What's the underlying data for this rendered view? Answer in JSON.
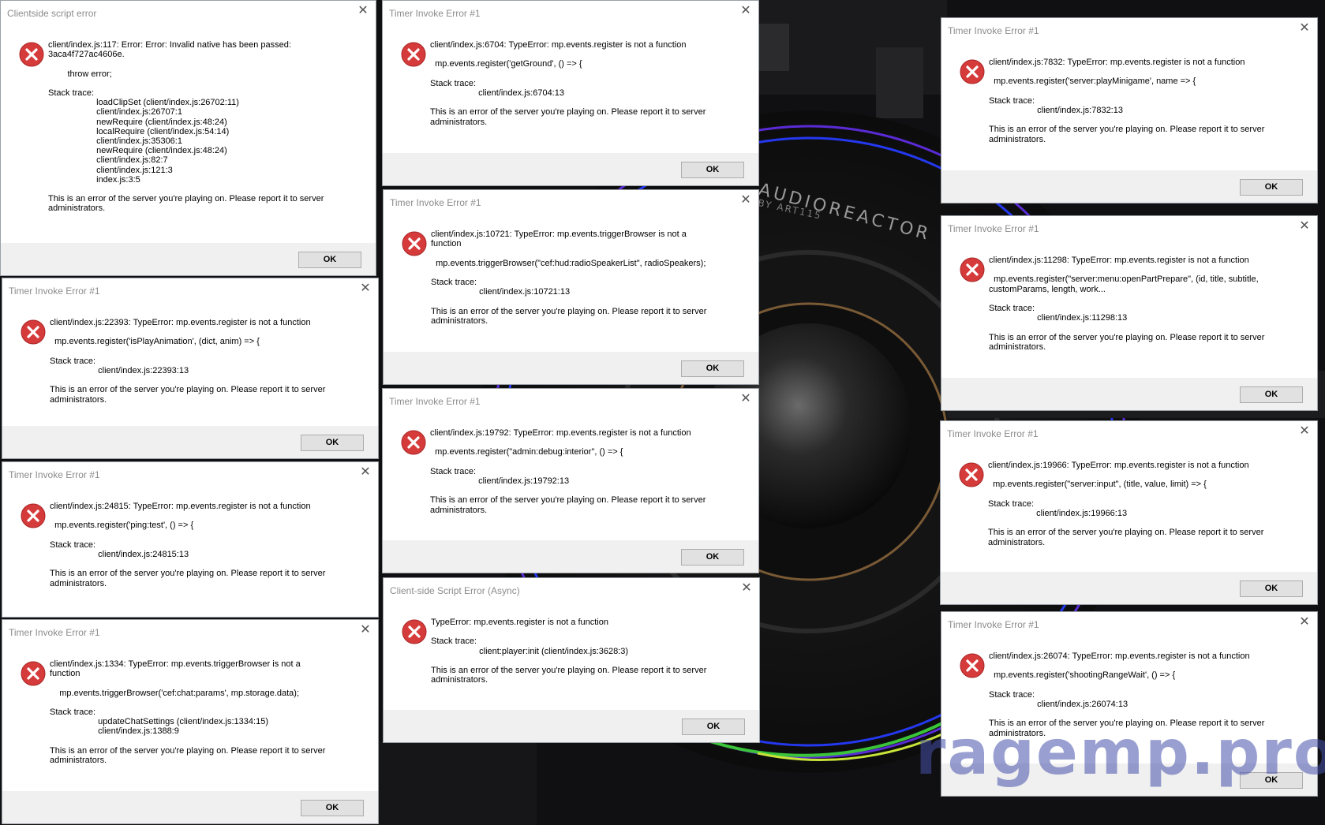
{
  "watermark": "ragemp.pro",
  "wallpaper_brand": "AUDIOREACTOR",
  "wallpaper_brand_sub": "BY ART115",
  "colors": {
    "error_icon": "#d63b3b",
    "dialog_footer": "#f0f0f0",
    "ring_purple": "#5a2bd6",
    "ring_blue": "#2438f0",
    "ring_green": "#39c43a",
    "ring_yellow": "#c8e33a"
  },
  "dialogs": [
    {
      "title": "Clientside script error",
      "message": "client/index.js:117: Error: Error: Invalid native has been passed:\n3aca4f727ac4606e.\n\n        throw error;\n\nStack trace:\n                    loadClipSet (client/index.js:26702:11)\n                    client/index.js:26707:1\n                    newRequire (client/index.js:48:24)\n                    localRequire (client/index.js:54:14)\n                    client/index.js:35306:1\n                    newRequire (client/index.js:48:24)\n                    client/index.js:82:7\n                    client/index.js:121:3\n                    index.js:3:5\n\nThis is an error of the server you're playing on. Please report it to server\nadministrators.",
      "ok_label": "OK"
    },
    {
      "title": "Timer Invoke Error #1",
      "message": "client/index.js:22393: TypeError: mp.events.register is not a function\n\n  mp.events.register('isPlayAnimation', (dict, anim) => {\n\nStack trace:\n                    client/index.js:22393:13\n\nThis is an error of the server you're playing on. Please report it to server\nadministrators.",
      "ok_label": "OK"
    },
    {
      "title": "Timer Invoke Error #1",
      "message": "client/index.js:24815: TypeError: mp.events.register is not a function\n\n  mp.events.register('ping:test', () => {\n\nStack trace:\n                    client/index.js:24815:13\n\nThis is an error of the server you're playing on. Please report it to server\nadministrators.",
      "ok_label": "OK"
    },
    {
      "title": "Timer Invoke Error #1",
      "message": "client/index.js:1334: TypeError: mp.events.triggerBrowser is not a\nfunction\n\n    mp.events.triggerBrowser('cef:chat:params', mp.storage.data);\n\nStack trace:\n                    updateChatSettings (client/index.js:1334:15)\n                    client/index.js:1388:9\n\nThis is an error of the server you're playing on. Please report it to server\nadministrators.",
      "ok_label": "OK"
    },
    {
      "title": "Timer Invoke Error #1",
      "message": "client/index.js:6704: TypeError: mp.events.register is not a function\n\n  mp.events.register('getGround', () => {\n\nStack trace:\n                    client/index.js:6704:13\n\nThis is an error of the server you're playing on. Please report it to server\nadministrators.",
      "ok_label": "OK"
    },
    {
      "title": "Timer Invoke Error #1",
      "message": "client/index.js:10721: TypeError: mp.events.triggerBrowser is not a\nfunction\n\n  mp.events.triggerBrowser(\"cef:hud:radioSpeakerList\", radioSpeakers);\n\nStack trace:\n                    client/index.js:10721:13\n\nThis is an error of the server you're playing on. Please report it to server\nadministrators.",
      "ok_label": "OK"
    },
    {
      "title": "Timer Invoke Error #1",
      "message": "client/index.js:19792: TypeError: mp.events.register is not a function\n\n  mp.events.register(\"admin:debug:interior\", () => {\n\nStack trace:\n                    client/index.js:19792:13\n\nThis is an error of the server you're playing on. Please report it to server\nadministrators.",
      "ok_label": "OK"
    },
    {
      "title": "Client-side Script Error (Async)",
      "message": "TypeError: mp.events.register is not a function\n\nStack trace:\n                    client:player:init (client/index.js:3628:3)\n\nThis is an error of the server you're playing on. Please report it to server\nadministrators.",
      "ok_label": "OK"
    },
    {
      "title": "Timer Invoke Error #1",
      "message": "client/index.js:7832: TypeError: mp.events.register is not a function\n\n  mp.events.register('server:playMinigame', name => {\n\nStack trace:\n                    client/index.js:7832:13\n\nThis is an error of the server you're playing on. Please report it to server\nadministrators.",
      "ok_label": "OK"
    },
    {
      "title": "Timer Invoke Error #1",
      "message": "client/index.js:11298: TypeError: mp.events.register is not a function\n\n  mp.events.register(\"server:menu:openPartPrepare\", (id, title, subtitle,\ncustomParams, length, work...\n\nStack trace:\n                    client/index.js:11298:13\n\nThis is an error of the server you're playing on. Please report it to server\nadministrators.",
      "ok_label": "OK"
    },
    {
      "title": "Timer Invoke Error #1",
      "message": "client/index.js:19966: TypeError: mp.events.register is not a function\n\n  mp.events.register(\"server:input\", (title, value, limit) => {\n\nStack trace:\n                    client/index.js:19966:13\n\nThis is an error of the server you're playing on. Please report it to server\nadministrators.",
      "ok_label": "OK"
    },
    {
      "title": "Timer Invoke Error #1",
      "message": "client/index.js:26074: TypeError: mp.events.register is not a function\n\n  mp.events.register('shootingRangeWait', () => {\n\nStack trace:\n                    client/index.js:26074:13\n\nThis is an error of the server you're playing on. Please report it to server\nadministrators.",
      "ok_label": "OK"
    }
  ]
}
